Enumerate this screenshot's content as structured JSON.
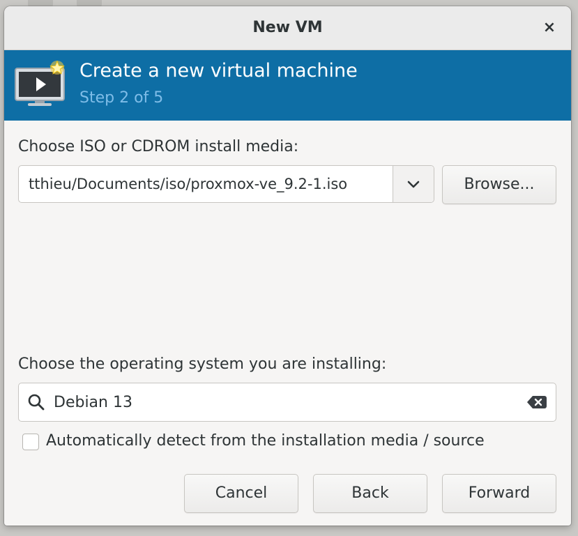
{
  "window": {
    "title": "New VM",
    "close_glyph": "×"
  },
  "banner": {
    "title": "Create a new virtual machine",
    "step": "Step 2 of 5",
    "icon": "monitor-play-icon",
    "bg_color": "#0e6ea5"
  },
  "install_media": {
    "label": "Choose ISO or CDROM install media:",
    "value": "tthieu/Documents/iso/proxmox-ve_9.2-1.iso",
    "browse_label": "Browse..."
  },
  "os": {
    "label": "Choose the operating system you are installing:",
    "search_value": "Debian 13",
    "auto_detect_label": "Automatically detect from the installation media / source",
    "auto_detect_checked": false
  },
  "buttons": {
    "cancel": "Cancel",
    "back": "Back",
    "forward": "Forward"
  }
}
